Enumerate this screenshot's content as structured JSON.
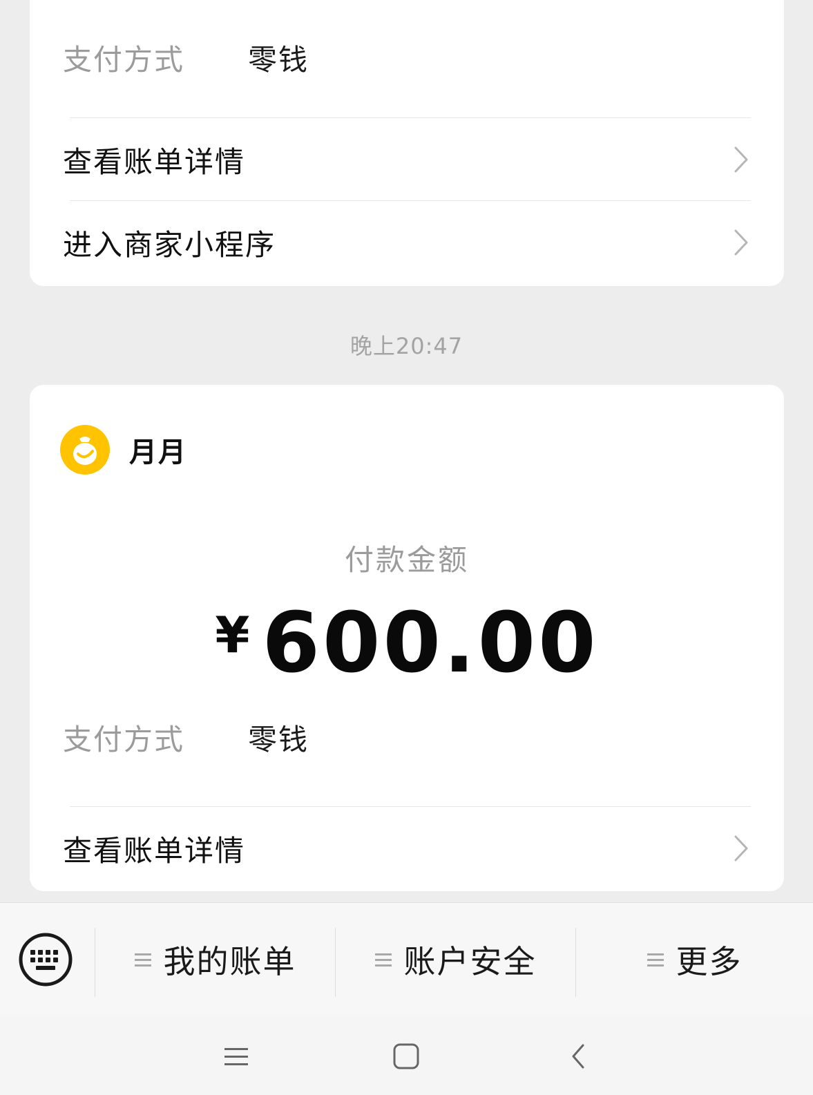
{
  "bill_prev": {
    "payment_method_label": "支付方式",
    "payment_method_value": "零钱",
    "view_bill_details": "查看账单详情",
    "enter_mini_program": "进入商家小程序"
  },
  "timestamp": "晚上20:47",
  "bill_current": {
    "merchant_name": "月月",
    "amount_label": "付款金额",
    "currency_symbol": "¥",
    "amount": "600.00",
    "payment_method_label": "支付方式",
    "payment_method_value": "零钱",
    "view_bill_details": "查看账单详情"
  },
  "menu": {
    "items": [
      {
        "label": "我的账单"
      },
      {
        "label": "账户安全"
      },
      {
        "label": "更多"
      }
    ]
  },
  "icons": {
    "merchant_logo": "yellow-smile-bag-icon",
    "keyboard": "keyboard-icon",
    "chevron": "chevron-right-icon",
    "menu": "hamburger-icon",
    "nav_menu": "recent-apps-icon",
    "nav_home": "home-square-icon",
    "nav_back": "back-arrow-icon"
  },
  "colors": {
    "background": "#ededed",
    "card": "#ffffff",
    "logo_yellow": "#ffc300",
    "muted_text": "#9b9b9b"
  }
}
